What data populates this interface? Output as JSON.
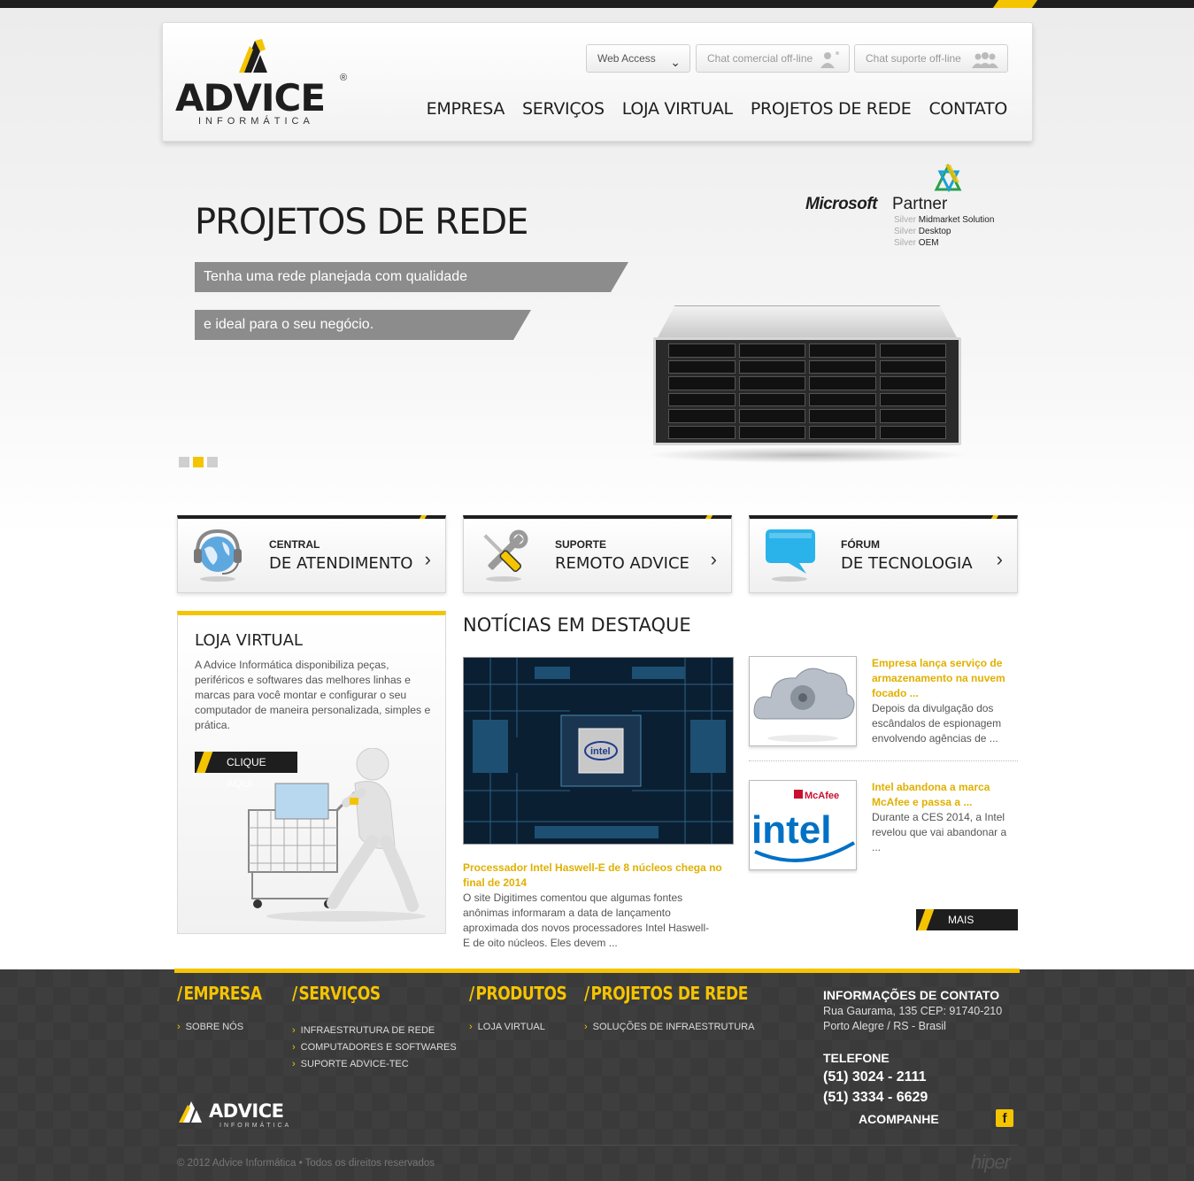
{
  "brand": {
    "name": "ADVICE",
    "reg": "®",
    "subtitle": "INFORMÁTICA",
    "accent_color": "#f5c400",
    "dark_color": "#1e1e1e"
  },
  "header": {
    "web_access": "Web Access",
    "chat_comercial": "Chat comercial off-line",
    "chat_suporte": "Chat suporte off-line",
    "nav": [
      "EMPRESA",
      "SERVIÇOS",
      "LOJA VIRTUAL",
      "PROJETOS DE REDE",
      "CONTATO"
    ]
  },
  "hero": {
    "title": "PROJETOS DE REDE",
    "line1": "Tenha uma rede planejada com qualidade",
    "line2": "e ideal para o seu negócio.",
    "slides_total": 3,
    "slide_active": 2,
    "partner": {
      "word1": "Microsoft",
      "word2": "Partner",
      "silver": "Silver",
      "c1": "Midmarket Solution",
      "c2": "Desktop",
      "c3": "OEM"
    }
  },
  "cards": [
    {
      "l1": "CENTRAL",
      "l2": "DE ATENDIMENTO",
      "icon": "headset-globe-icon"
    },
    {
      "l1": "SUPORTE",
      "l2": "REMOTO ADVICE",
      "icon": "tools-icon"
    },
    {
      "l1": "FÓRUM",
      "l2": "DE TECNOLOGIA",
      "icon": "speech-bubble-icon"
    }
  ],
  "loja": {
    "title": "LOJA VIRTUAL",
    "text": "A Advice Informática disponibiliza peças, periféricos e softwares das melhores linhas e marcas para você montar e configurar o seu computador de maneira personalizada, simples e prática.",
    "button": "CLIQUE AQUI"
  },
  "news": {
    "title": "NOTÍCIAS EM DESTAQUE",
    "main": {
      "headline": "Processador Intel Haswell-E de 8 núcleos chega no final de 2014",
      "text": "O site Digitimes comentou que algumas fontes anônimas informaram a data de lançamento aproximada dos novos processadores Intel Haswell-E de oito núcleos. Eles devem ..."
    },
    "side": [
      {
        "headline": "Empresa lança serviço de armazenamento na nuvem focado ...",
        "text": "Depois da divulgação dos escândalos de espionagem envolvendo agências de ..."
      },
      {
        "headline": "Intel abandona a marca McAfee e passa a ...",
        "text": "Durante a CES 2014, a Intel revelou que vai abandonar a ..."
      }
    ],
    "more": "MAIS NOTÍCIAS"
  },
  "footer": {
    "cols": [
      {
        "title": "EMPRESA",
        "links": [
          "SOBRE NÓS"
        ]
      },
      {
        "title": "SERVIÇOS",
        "links": [
          "INFRAESTRUTURA DE REDE",
          "COMPUTADORES E SOFTWARES",
          "SUPORTE ADVICE-TEC"
        ]
      },
      {
        "title": "PRODUTOS",
        "links": [
          "LOJA VIRTUAL"
        ]
      },
      {
        "title": "PROJETOS DE REDE",
        "links": [
          "SOLUÇÕES DE INFRAESTRUTURA"
        ]
      }
    ],
    "contact": {
      "title": "INFORMAÇÕES DE CONTATO",
      "address1": "Rua Gaurama, 135 CEP: 91740-210",
      "address2": "Porto Alegre / RS - Brasil",
      "phone_title": "TELEFONE",
      "phone1": "(51) 3024 - 2111",
      "phone2": "(51) 3334 - 6629",
      "follow": "ACOMPANHE"
    },
    "copyright": "© 2012 Advice Informática • Todos os direitos reservados",
    "agency": "hiper"
  },
  "icons": {
    "chevron": "›",
    "chevron_down": "⌄"
  }
}
